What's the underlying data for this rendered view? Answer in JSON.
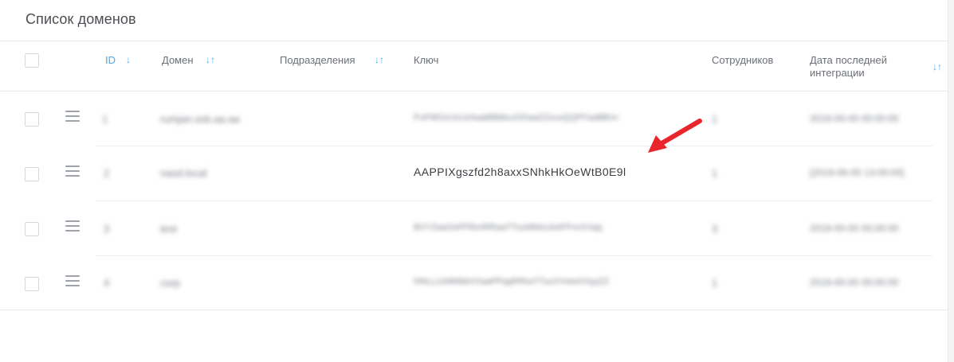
{
  "title": "Список доменов",
  "columns": {
    "id": "ID",
    "domain": "Домен",
    "divisions": "Подразделения",
    "key": "Ключ",
    "employees": "Сотрудников",
    "last_integration": "Дата последней интеграции"
  },
  "sort_icons": {
    "id": "↓",
    "domain": "↓↑",
    "divisions": "↓↑",
    "last_integration": "↓↑"
  },
  "rows": [
    {
      "id": "1",
      "domain": "rumjan.ssb.aa.aa",
      "divisions": "",
      "key": "PuFMOzUzUzAaaBBbbccDDaaZZzuuQQFFaaBBnn",
      "employees": "1",
      "last_integration": "2019-00-00 00:00:00"
    },
    {
      "id": "2",
      "domain": "nasd.local",
      "divisions": "",
      "key": "AAPPIXgszfd2h8axxSNhkHkOeWtB0E9l",
      "employees": "1",
      "last_integration": "[2019-06-00 13:00:00]"
    },
    {
      "id": "3",
      "domain": "test",
      "divisions": "",
      "key": "BXYZaaOoPPllnnRRaaTTuuMMzzAAFFvvXXqq",
      "employees": "3",
      "last_integration": "2019-00-00 00:00:00"
    },
    {
      "id": "4",
      "domain": "corp",
      "divisions": "",
      "key": "NNLLzzMMbbXXaaPPqqRRssTTuuVVwwXXyyZZ",
      "employees": "1",
      "last_integration": "2019-00-00 00:00:00"
    }
  ],
  "annotation": {
    "color": "#e8262b",
    "icon": "arrow-icon"
  }
}
